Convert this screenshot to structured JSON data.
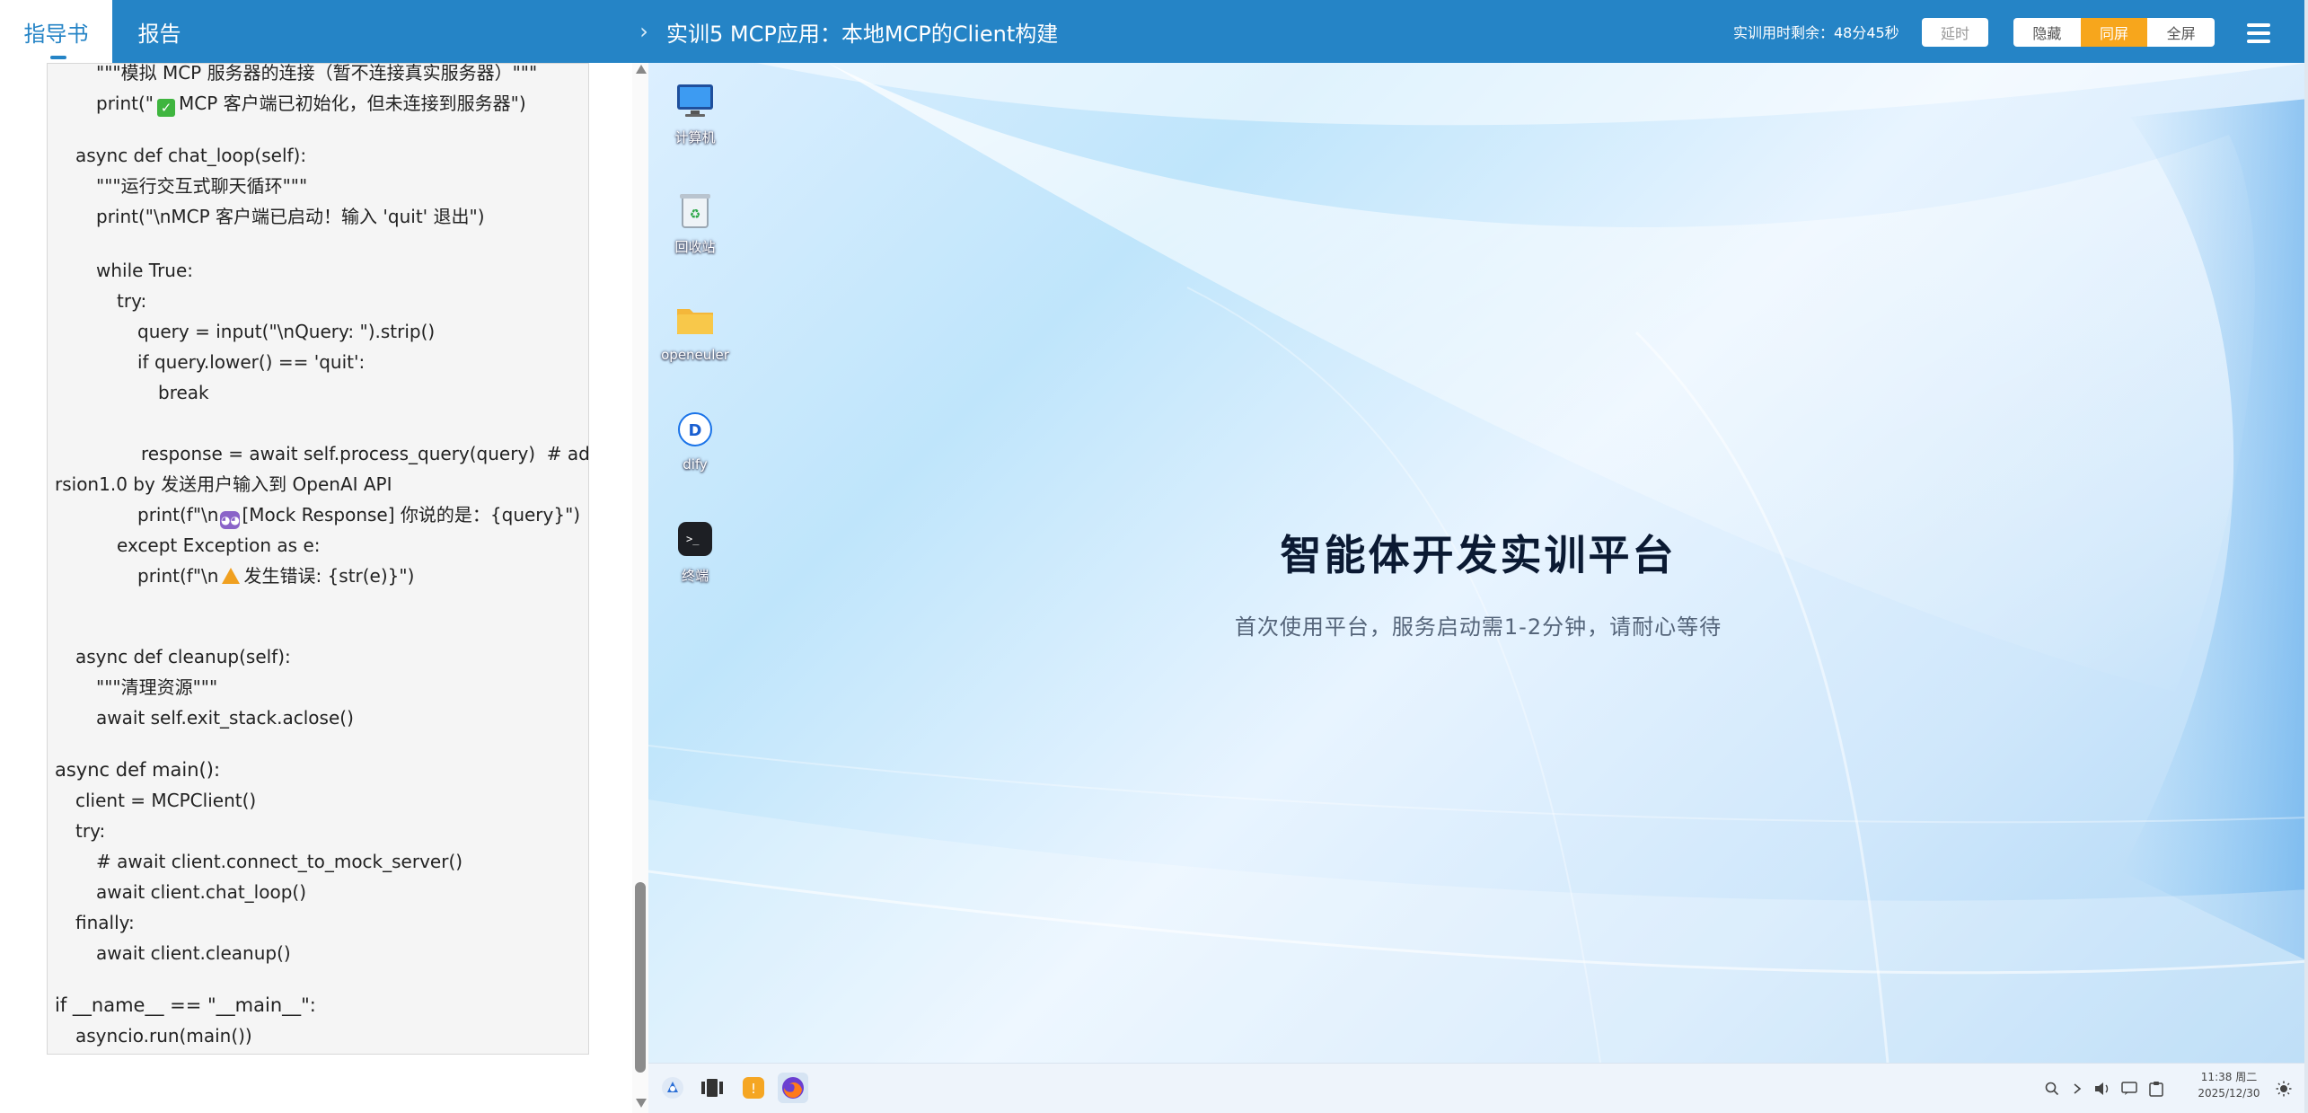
{
  "header": {
    "tab_guide": "指导书",
    "tab_report": "报告",
    "collapse": "›",
    "title": "实训5 MCP应用：本地MCP的Client构建",
    "timer": "实训用时剩余：48分45秒",
    "extend_label": "延时",
    "hide_label": "隐藏",
    "same_screen_label": "同屏",
    "fullscreen_label": "全屏"
  },
  "code": {
    "l1": "\"\"\"模拟 MCP 服务器的连接（暂不连接真实服务器）\"\"\"",
    "l2a": "print(\"",
    "l2b": "MCP 客户端已初始化，但未连接到服务器\")",
    "l3": "async def chat_loop(self):",
    "l4": "\"\"\"运行交互式聊天循环\"\"\"",
    "l5": "print(\"\\nMCP 客户端已启动！输入 'quit' 退出\")",
    "l6": "while True:",
    "l7": "try:",
    "l8": "query = input(\"\\nQuery: \").strip()",
    "l9": "if query.lower() == 'quit':",
    "l10": "break",
    "l11": "response = await self.process_query(query)  # add ve",
    "l12": "rsion1.0 by 发送用户输入到 OpenAI API",
    "l13a": "print(f\"\\n",
    "l13b": "[Mock Response] 你说的是：{query}\")",
    "l14": "except Exception as e:",
    "l15a": "print(f\"\\n",
    "l15b": "发生错误: {str(e)}\")",
    "l16": "async def cleanup(self):",
    "l17": "\"\"\"清理资源\"\"\"",
    "l18": "await self.exit_stack.aclose()",
    "l19": "async def main():",
    "l20": "client = MCPClient()",
    "l21": "try:",
    "l22": "# await client.connect_to_mock_server()",
    "l23": "await client.chat_loop()",
    "l24": "finally:",
    "l25": "await client.cleanup()",
    "l26": "if __name__ == \"__main__\":",
    "l27": "asyncio.run(main())"
  },
  "desktop": {
    "icons": {
      "computer": "计算机",
      "trash": "回收站",
      "openeuler": "openeuler",
      "dify": "dify",
      "terminal": "终端"
    },
    "hero_title": "智能体开发实训平台",
    "hero_subtitle": "首次使用平台，服务启动需1-2分钟，请耐心等待"
  },
  "taskbar": {
    "time": "11:38 周二",
    "date": "2025/12/30"
  }
}
